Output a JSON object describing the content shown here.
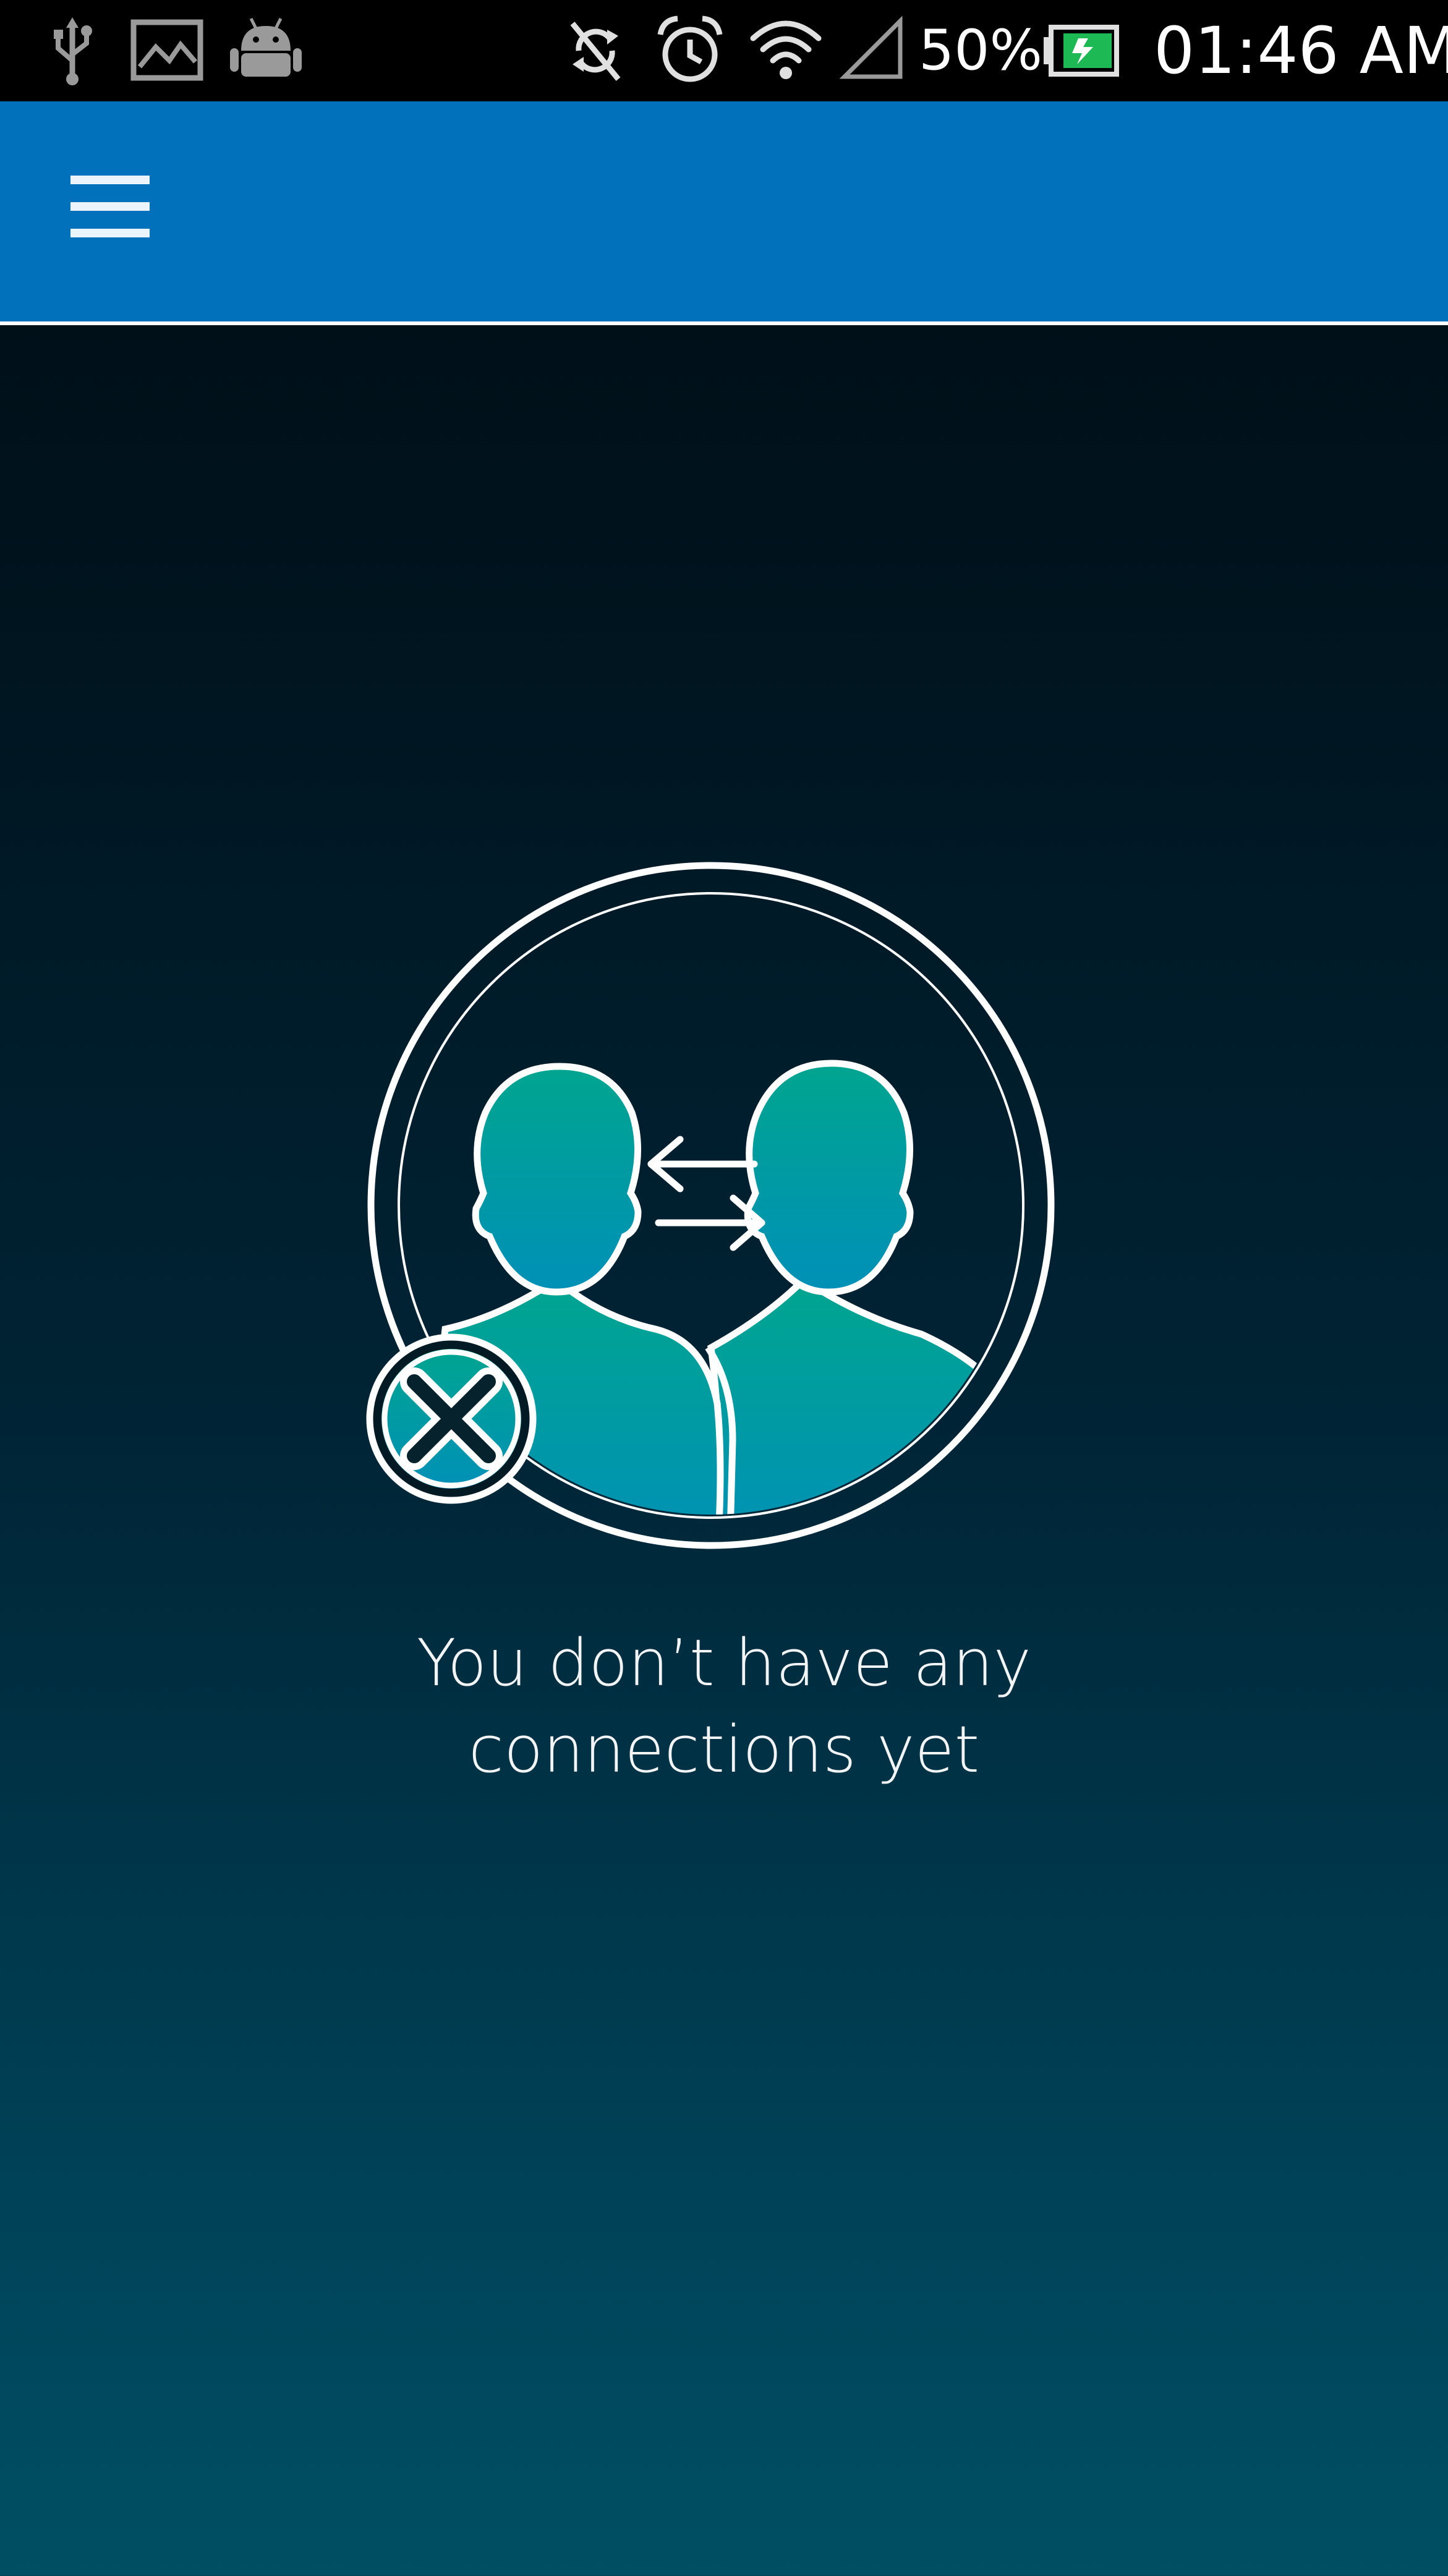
{
  "status_bar": {
    "battery_percent": "50%",
    "time": "01:46 AM",
    "left_icons": [
      "usb-icon",
      "image-icon",
      "android-icon"
    ],
    "right_icons": [
      "sync-disabled-icon",
      "alarm-icon",
      "wifi-icon",
      "signal-icon",
      "battery-charging-icon"
    ]
  },
  "app_bar": {
    "menu_icon": "hamburger-menu-icon",
    "color": "#0071ba"
  },
  "empty_state": {
    "icon": "connections-disabled-icon",
    "message_line1": "You don’t have any",
    "message_line2": "connections yet"
  },
  "colors": {
    "background_top": "#000d14",
    "background_bottom": "#004f63",
    "accent_teal": "#00a58f",
    "accent_blue": "#0090b8"
  }
}
